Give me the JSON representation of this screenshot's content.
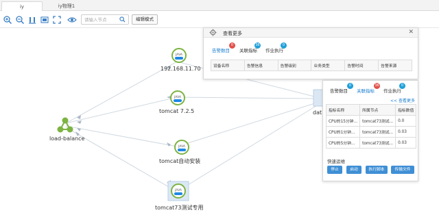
{
  "tabs": [
    {
      "label": "iy"
    },
    {
      "label": "iy物理1"
    }
  ],
  "toolbar": {
    "search_placeholder": "请输入节点",
    "edit_mode_label": "编辑模式"
  },
  "nodes": {
    "java_badge": "JAVA",
    "host": {
      "label": "192.168.11.70"
    },
    "tomcat725": {
      "label": "tomcat 7.2.5"
    },
    "loadbalance": {
      "label": "load-balance"
    },
    "tomcat_auto": {
      "label": "tomcat自动安装"
    },
    "tomcat73": {
      "label": "tomcat73测试专用"
    },
    "partial": {
      "label": "dat"
    }
  },
  "popup_more": {
    "title": "查看更多",
    "tabs": [
      {
        "label": "告警数目",
        "badge": "0"
      },
      {
        "label": "关联指标",
        "badge": "36"
      },
      {
        "label": "作业执行",
        "badge": "0"
      }
    ],
    "columns": [
      "设备名称",
      "告警信息",
      "告警级别",
      "业务类型",
      "告警时间",
      "告警来源"
    ]
  },
  "popup_detail": {
    "tabs": [
      {
        "label": "告警数目",
        "badge": "0"
      },
      {
        "label": "关联指标",
        "badge": "36"
      },
      {
        "label": "作业执行",
        "badge": "0"
      }
    ],
    "more_link": "<< 查看更多",
    "columns": [
      "指标名称",
      "所属节点",
      "指标数值"
    ],
    "rows": [
      [
        "CPU的15分钟...",
        "tomcat73测试...",
        "0.0"
      ],
      [
        "CPU的1分钟...",
        "tomcat73测试...",
        "0.03"
      ],
      [
        "CPU的5分钟...",
        "tomcat73测试...",
        "0.03"
      ]
    ],
    "quick_ops_label": "快速运维",
    "buttons": [
      "停止",
      "启动",
      "执行脚本",
      "传输文件"
    ]
  },
  "colors": {
    "accent": "#3f8fd5",
    "badge_red": "#e0504a",
    "badge_blue": "#1f9fd9",
    "node_green": "#7cb342",
    "java_blue": "#1e88e5"
  }
}
